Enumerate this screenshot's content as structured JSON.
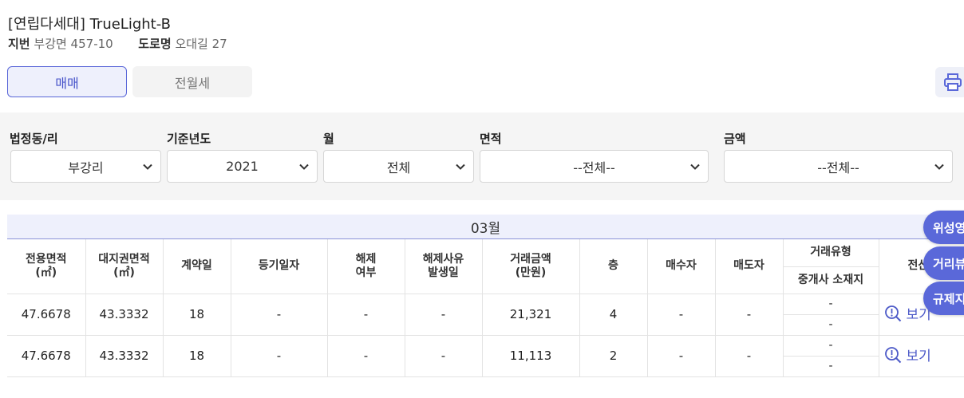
{
  "header": {
    "title": "[연립다세대] TrueLight-B",
    "lot_label": "지번",
    "lot_value": "부강면 457-10",
    "road_label": "도로명",
    "road_value": "오대길 27"
  },
  "tabs": [
    {
      "label": "매매",
      "active": true
    },
    {
      "label": "전월세",
      "active": false
    }
  ],
  "filters": {
    "dong": {
      "label": "법정동/리",
      "value": "부강리"
    },
    "year": {
      "label": "기준년도",
      "value": "2021"
    },
    "month": {
      "label": "월",
      "value": "전체"
    },
    "area": {
      "label": "면적",
      "value": "--전체--"
    },
    "price": {
      "label": "금액",
      "value": "--전체--"
    }
  },
  "table": {
    "month_header": "03월",
    "columns": {
      "area": [
        "전용면적",
        "(㎡)"
      ],
      "land": [
        "대지권면적",
        "(㎡)"
      ],
      "contract_day": "계약일",
      "reg_date": "등기일자",
      "cancel": [
        "해제",
        "여부"
      ],
      "cancel_date": [
        "해제사유",
        "발생일"
      ],
      "price": [
        "거래금액",
        "(만원)"
      ],
      "floor": "층",
      "buyer": "매수자",
      "seller": "매도자",
      "deal_type": "거래유형",
      "agent_loc": "중개사 소재지",
      "doc": "전산"
    },
    "rows": [
      {
        "area": "47.6678",
        "land": "43.3332",
        "day": "18",
        "reg": "-",
        "cancel": "-",
        "cancel_date": "-",
        "price": "21,321",
        "floor": "4",
        "buyer": "-",
        "seller": "-",
        "deal_type": "-",
        "agent_loc": "-",
        "view": "보기"
      },
      {
        "area": "47.6678",
        "land": "43.3332",
        "day": "18",
        "reg": "-",
        "cancel": "-",
        "cancel_date": "-",
        "price": "11,113",
        "floor": "2",
        "buyer": "-",
        "seller": "-",
        "deal_type": "-",
        "agent_loc": "-",
        "view": "보기"
      }
    ]
  },
  "floating": [
    "위성영",
    "거리뷰",
    "규제지"
  ],
  "icons": {
    "print": "printer-icon",
    "view": "magnifier-icon",
    "select": "chevron-down-icon"
  },
  "colors": {
    "accent": "#5a68d9",
    "accent_light": "#eef0fc",
    "filter_bg": "#f5f5f5"
  }
}
